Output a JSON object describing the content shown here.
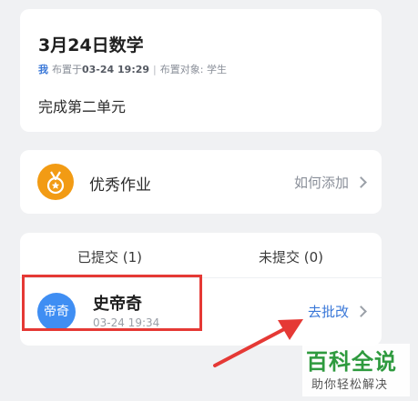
{
  "assignment": {
    "title": "3月24日数学",
    "owner": "我",
    "assigned_prefix": "布置于",
    "assigned_time": "03-24 19:29",
    "target_text": "布置对象: 学生",
    "separator": "|",
    "description": "完成第二单元"
  },
  "excellent": {
    "label": "优秀作业",
    "action": "如何添加",
    "icon": "medal-icon"
  },
  "submissions": {
    "tabs": [
      {
        "label": "已提交 (1)",
        "active": true
      },
      {
        "label": "未提交 (0)",
        "active": false
      }
    ],
    "students": [
      {
        "avatar_text": "帝奇",
        "name": "史帝奇",
        "time": "03-24 19:34",
        "action": "去批改"
      }
    ]
  },
  "watermark": {
    "main": "百科全说",
    "sub": "助你轻松解决"
  },
  "colors": {
    "accent": "#3a78d8",
    "medal": "#f29b14",
    "highlight": "#e53935",
    "watermark": "#2e9a3e"
  }
}
